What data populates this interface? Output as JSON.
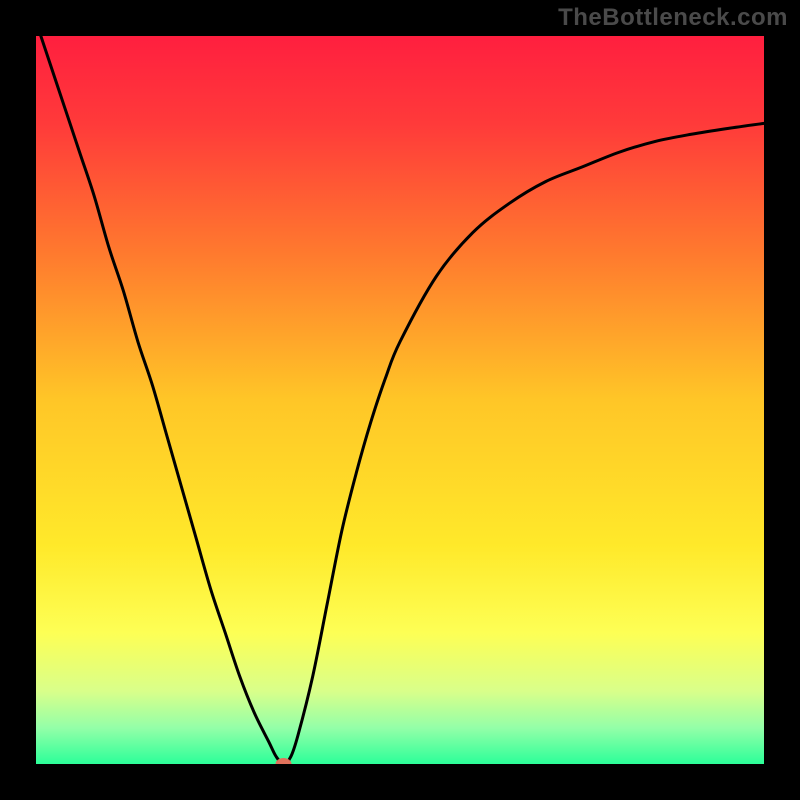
{
  "watermark": {
    "text": "TheBottleneck.com"
  },
  "chart_data": {
    "type": "line",
    "title": "",
    "subtitle": "",
    "xlabel": "",
    "ylabel": "",
    "xlim": [
      0,
      100
    ],
    "ylim": [
      0,
      100
    ],
    "grid": false,
    "legend": false,
    "x": [
      0,
      2,
      4,
      6,
      8,
      10,
      12,
      14,
      16,
      18,
      20,
      22,
      24,
      26,
      28,
      30,
      32,
      33,
      34,
      35,
      36,
      38,
      40,
      42,
      44,
      46,
      48,
      50,
      55,
      60,
      65,
      70,
      75,
      80,
      85,
      90,
      95,
      100
    ],
    "series": [
      {
        "name": "curve",
        "values": [
          102,
          96,
          90,
          84,
          78,
          71,
          65,
          58,
          52,
          45,
          38,
          31,
          24,
          18,
          12,
          7,
          3,
          1,
          0,
          1,
          4,
          12,
          22,
          32,
          40,
          47,
          53,
          58,
          67,
          73,
          77,
          80,
          82,
          84,
          85.5,
          86.5,
          87.3,
          88
        ]
      }
    ],
    "annotations": [
      {
        "name": "min-point",
        "x": 34,
        "y": 0
      }
    ],
    "background_gradient": {
      "stops": [
        {
          "offset": 0.0,
          "color": "#ff1f3f"
        },
        {
          "offset": 0.12,
          "color": "#ff3a3a"
        },
        {
          "offset": 0.3,
          "color": "#ff7a2e"
        },
        {
          "offset": 0.5,
          "color": "#ffc627"
        },
        {
          "offset": 0.7,
          "color": "#ffe92a"
        },
        {
          "offset": 0.82,
          "color": "#fdff55"
        },
        {
          "offset": 0.9,
          "color": "#d9ff8a"
        },
        {
          "offset": 0.95,
          "color": "#94ffa8"
        },
        {
          "offset": 1.0,
          "color": "#2cff99"
        }
      ]
    },
    "marker": {
      "color": "#e0725c",
      "rx": 8,
      "ry": 6
    }
  }
}
